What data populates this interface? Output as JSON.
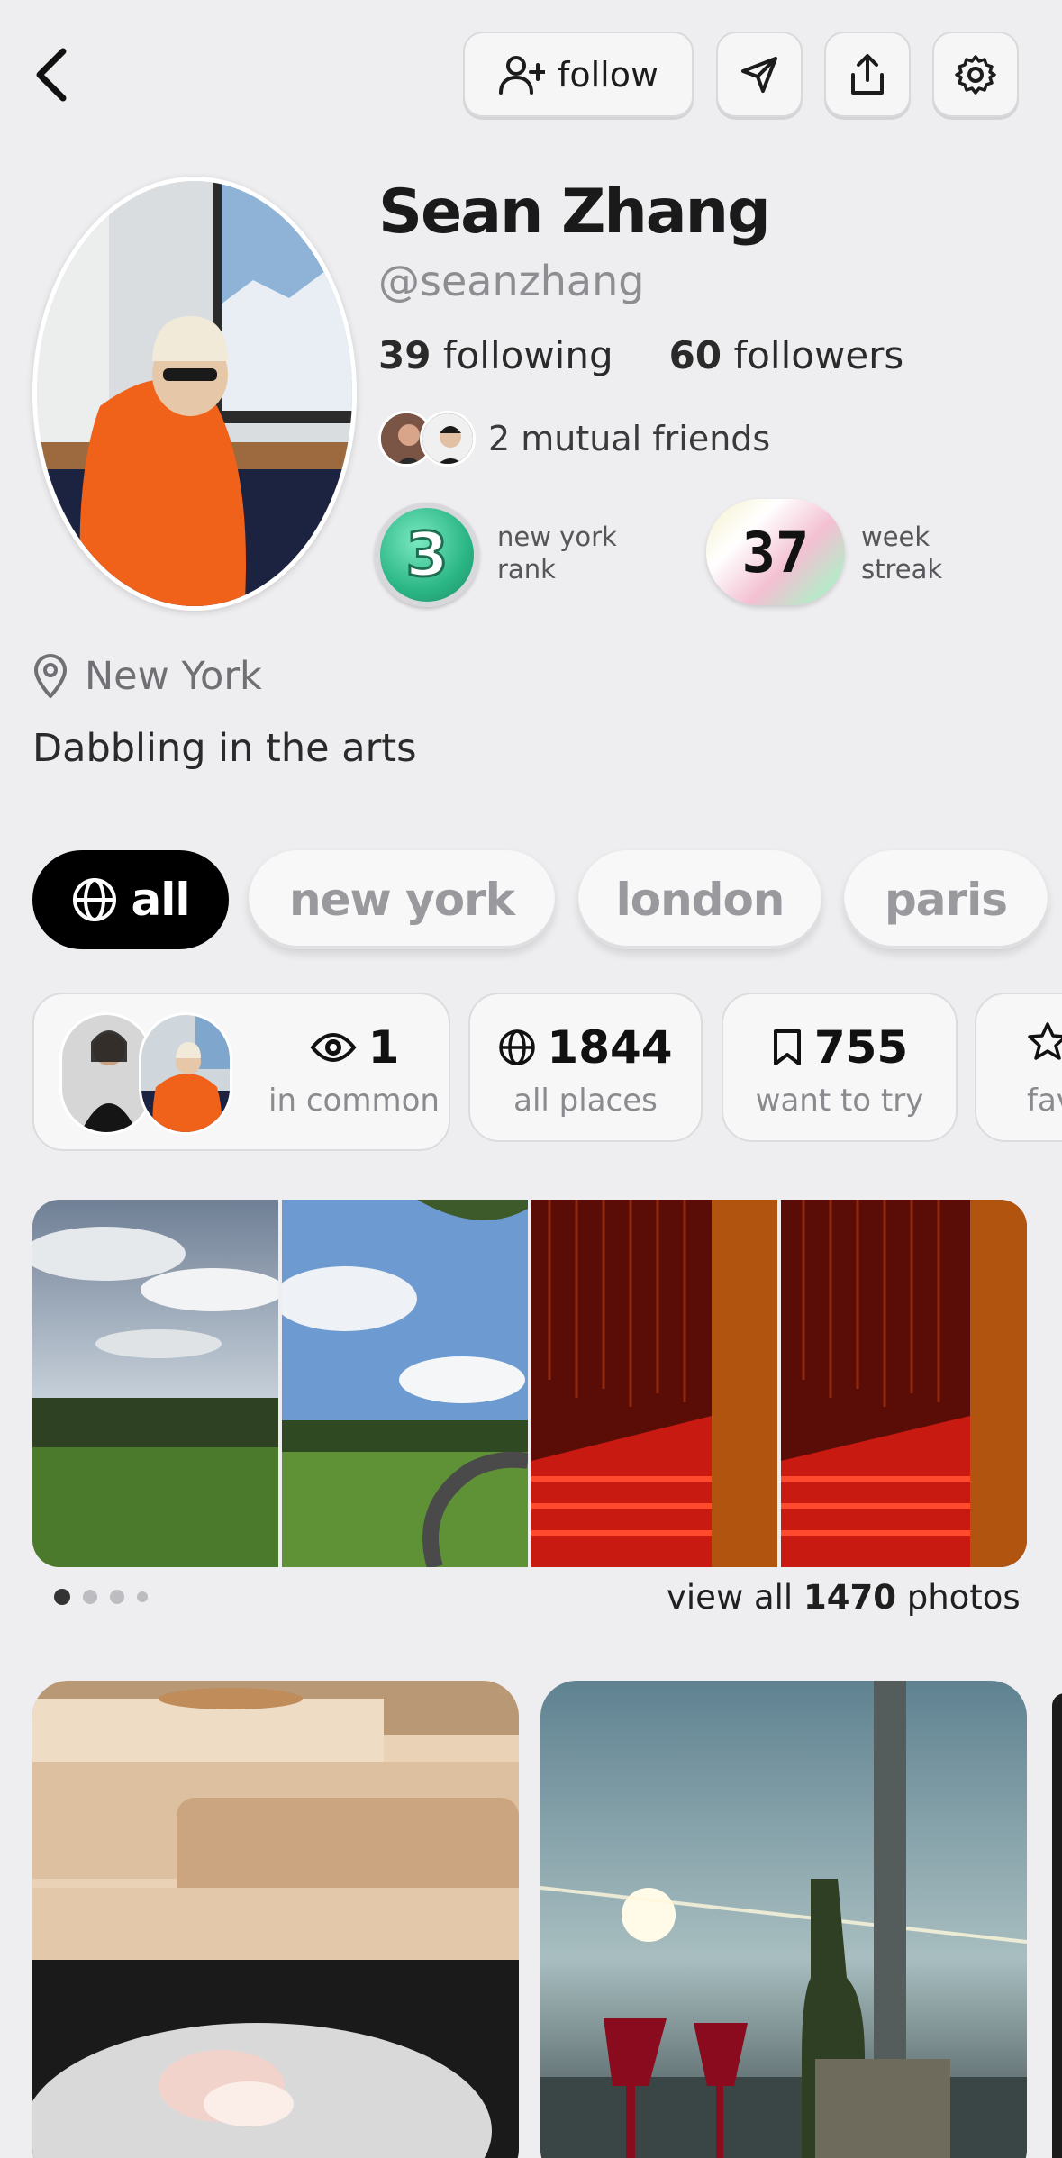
{
  "top_bar": {
    "follow_label": "follow"
  },
  "profile": {
    "name": "Sean Zhang",
    "handle": "@seanzhang",
    "following_count": "39",
    "following_label": "following",
    "followers_count": "60",
    "followers_label": "followers",
    "mutual_friends": "2 mutual friends",
    "rank_number": "3",
    "rank_label": "new york rank",
    "streak_number": "37",
    "streak_label": "week streak",
    "location": "New York",
    "bio": "Dabbling in the arts"
  },
  "filters": [
    {
      "label": "all",
      "active": true
    },
    {
      "label": "new york",
      "active": false
    },
    {
      "label": "london",
      "active": false
    },
    {
      "label": "paris",
      "active": false
    }
  ],
  "stat_cards": {
    "in_common_count": "1",
    "in_common_label": "in common",
    "all_places_count": "1844",
    "all_places_label": "all places",
    "want_to_try_count": "755",
    "want_to_try_label": "want to try",
    "favorites_label": "fav"
  },
  "photos": {
    "view_all_prefix": "view all",
    "view_all_count": "1470",
    "view_all_suffix": "photos"
  },
  "colors": {
    "background": "#eeeef0",
    "active_chip": "#000000",
    "rank_green": "#2bb685",
    "photo_red": "#c81a10"
  }
}
